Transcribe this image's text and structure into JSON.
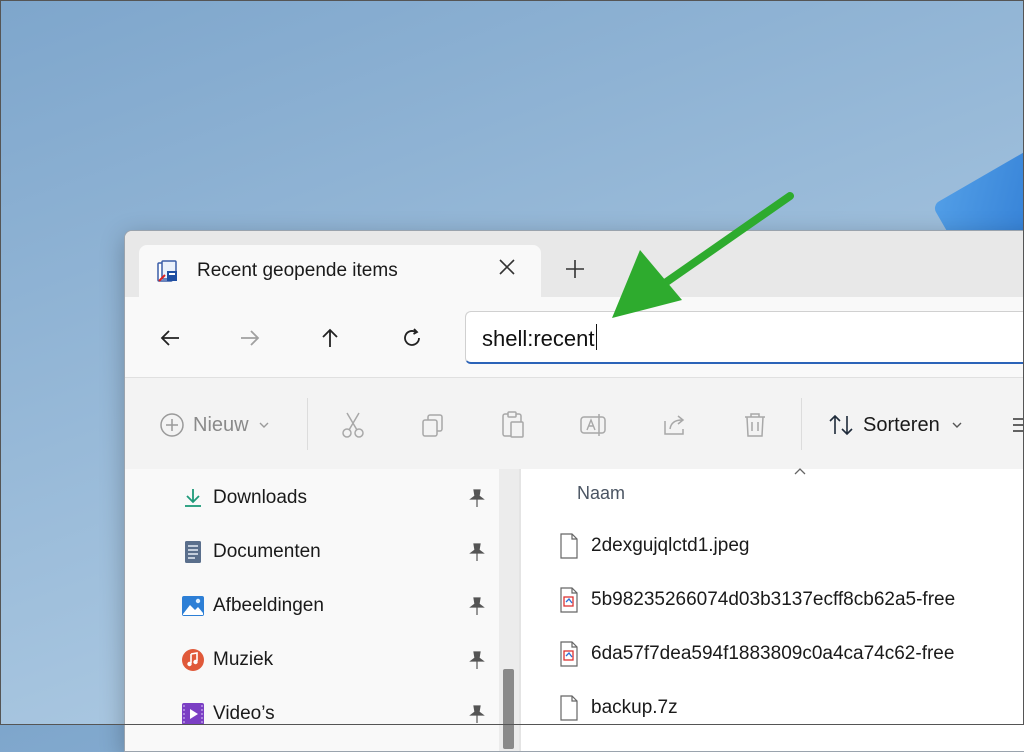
{
  "tab": {
    "title": "Recent geopende items",
    "close_label": "✕",
    "new_tab_label": "+"
  },
  "nav": {
    "back": "back",
    "forward": "forward",
    "up": "up",
    "refresh": "refresh"
  },
  "address": {
    "value": "shell:recent"
  },
  "toolbar": {
    "new_label": "Nieuw",
    "sort_label": "Sorteren"
  },
  "sidebar": {
    "items": [
      {
        "label": "Downloads",
        "icon": "download-icon"
      },
      {
        "label": "Documenten",
        "icon": "documents-icon"
      },
      {
        "label": "Afbeeldingen",
        "icon": "pictures-icon"
      },
      {
        "label": "Muziek",
        "icon": "music-icon"
      },
      {
        "label": "Video’s",
        "icon": "videos-icon"
      }
    ]
  },
  "content": {
    "column_name": "Naam",
    "files": [
      {
        "name": "2dexgujqlctd1.jpeg",
        "icon": "file-icon"
      },
      {
        "name": "5b98235266074d03b3137ecff8cb62a5-free",
        "icon": "image-file-icon"
      },
      {
        "name": "6da57f7dea594f1883809c0a4ca74c62-free",
        "icon": "image-file-icon"
      },
      {
        "name": "backup.7z",
        "icon": "file-icon"
      }
    ]
  },
  "colors": {
    "accent": "#2b63b8",
    "annotation_arrow": "#2eab2e"
  }
}
